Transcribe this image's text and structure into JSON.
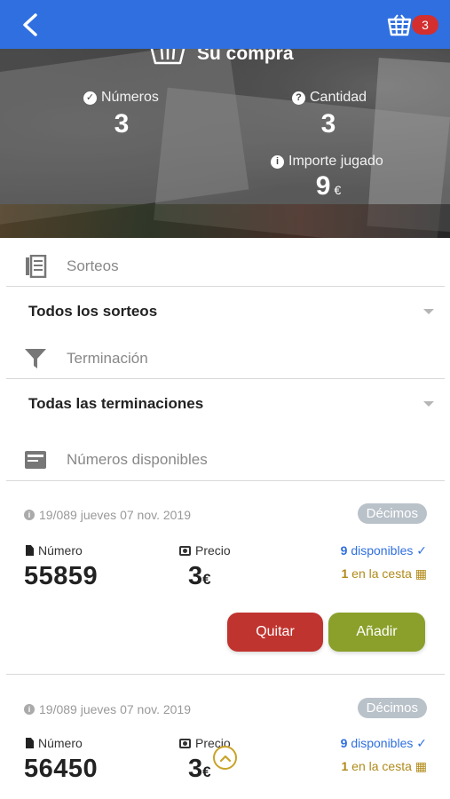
{
  "header": {
    "back_icon": "chevron-left-icon",
    "cart_icon": "basket-icon",
    "cart_count": "3",
    "accent": "#2f6fe0"
  },
  "summary": {
    "title": "Su compra",
    "numbers_label": "Números",
    "numbers_value": "3",
    "quantity_label": "Cantidad",
    "quantity_value": "3",
    "amount_label": "Importe jugado",
    "amount_value": "9",
    "amount_currency": "€"
  },
  "filters": {
    "draws_label": "Sorteos",
    "draws_value": "Todos los sorteos",
    "ending_label": "Terminación",
    "ending_value": "Todas las terminaciones",
    "available_label": "Números disponibles"
  },
  "tickets": [
    {
      "date": "19/089 jueves 07 nov. 2019",
      "tag": "Décimos",
      "number_label": "Número",
      "number": "55859",
      "price_label": "Precio",
      "price": "3",
      "currency": "€",
      "available_count": "9",
      "available_text": "disponibles",
      "cart_count": "1",
      "cart_text": "en la cesta",
      "remove_label": "Quitar",
      "add_label": "Añadir"
    },
    {
      "date": "19/089 jueves 07 nov. 2019",
      "tag": "Décimos",
      "number_label": "Número",
      "number": "56450",
      "price_label": "Precio",
      "price": "3",
      "currency": "€",
      "available_count": "9",
      "available_text": "disponibles",
      "cart_count": "1",
      "cart_text": "en la cesta"
    }
  ]
}
